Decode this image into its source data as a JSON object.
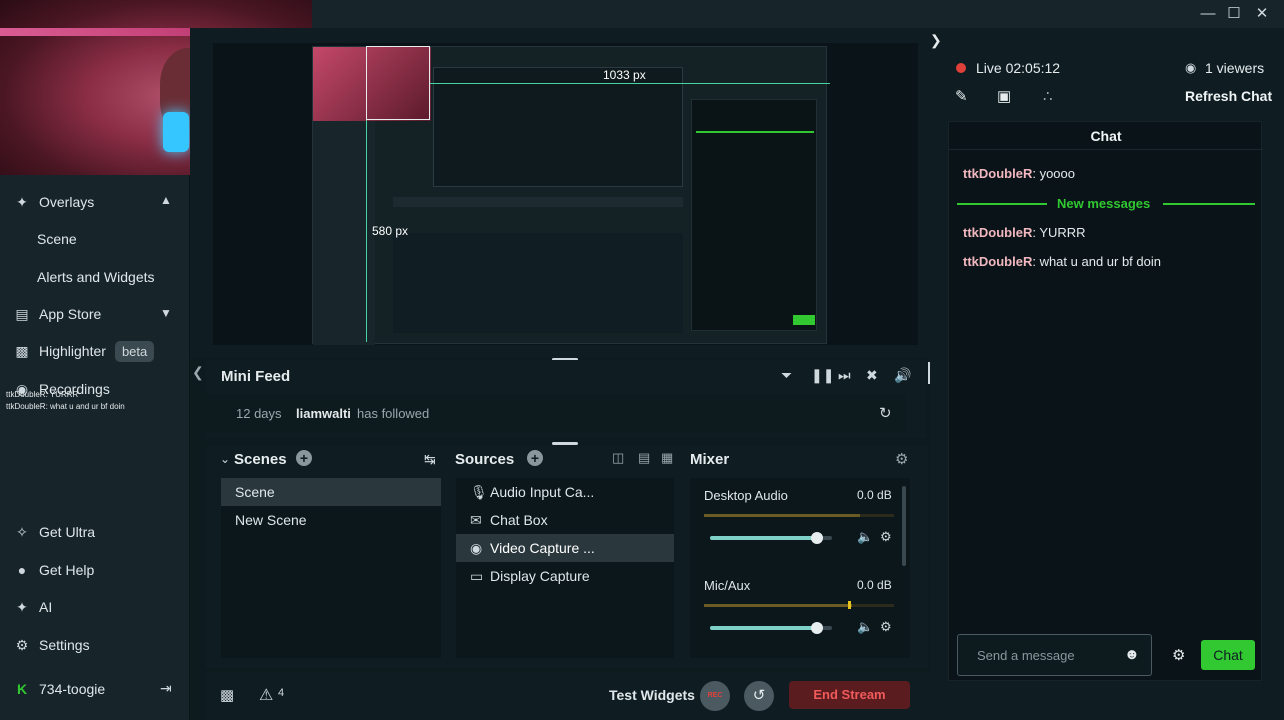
{
  "sidebar": {
    "items": [
      {
        "label": "Overlays",
        "icon": "brush-icon"
      },
      {
        "label": "Scene"
      },
      {
        "label": "Alerts and Widgets"
      },
      {
        "label": "App Store",
        "icon": "store-icon"
      },
      {
        "label": "Highlighter",
        "icon": "highlighter-icon",
        "badge": "beta"
      },
      {
        "label": "Recordings",
        "icon": "recordings-icon"
      }
    ],
    "overlay_chat": [
      "ttkDoubleR: YURRR",
      "ttkDoubleR: what u and ur bf doin"
    ],
    "bottom": [
      {
        "label": "Get Ultra",
        "icon": "ultra-icon"
      },
      {
        "label": "Get Help",
        "icon": "help-icon"
      },
      {
        "label": "AI",
        "icon": "ai-icon"
      },
      {
        "label": "Settings",
        "icon": "settings-icon"
      }
    ],
    "user": "734-toogie"
  },
  "preview": {
    "dim_width": "1033 px",
    "dim_height": "580 px"
  },
  "mini_feed": {
    "title": "Mini Feed",
    "event_time": "12 days",
    "event_user": "liamwalti",
    "event_text": "has followed"
  },
  "scenes": {
    "title": "Scenes",
    "items": [
      "Scene",
      "New Scene"
    ]
  },
  "sources": {
    "title": "Sources",
    "items": [
      "Audio Input Ca...",
      "Chat Box",
      "Video Capture ...",
      "Display Capture"
    ]
  },
  "mixer": {
    "title": "Mixer",
    "channels": [
      {
        "name": "Desktop Audio",
        "db": "0.0 dB",
        "level": 0.88
      },
      {
        "name": "Mic/Aux",
        "db": "0.0 dB",
        "level": 0.88
      }
    ]
  },
  "footer": {
    "alerts_count": "4",
    "test_widgets": "Test Widgets",
    "rec": "REC",
    "end_stream": "End Stream"
  },
  "chat": {
    "live_label": "Live 02:05:12",
    "viewers": "1 viewers",
    "refresh": "Refresh Chat",
    "title": "Chat",
    "messages": [
      {
        "user": "ttkDoubleR",
        "text": ": yoooo"
      },
      {
        "user": "ttkDoubleR",
        "text": ": YURRR"
      },
      {
        "user": "ttkDoubleR",
        "text": ": what u and ur bf doin"
      }
    ],
    "new_messages": "New messages",
    "input_placeholder": "Send a message",
    "send_label": "Chat"
  },
  "colors": {
    "accent_green": "#31c831",
    "live_red": "#e0403a",
    "end_stream_bg": "#5a1c1f"
  }
}
